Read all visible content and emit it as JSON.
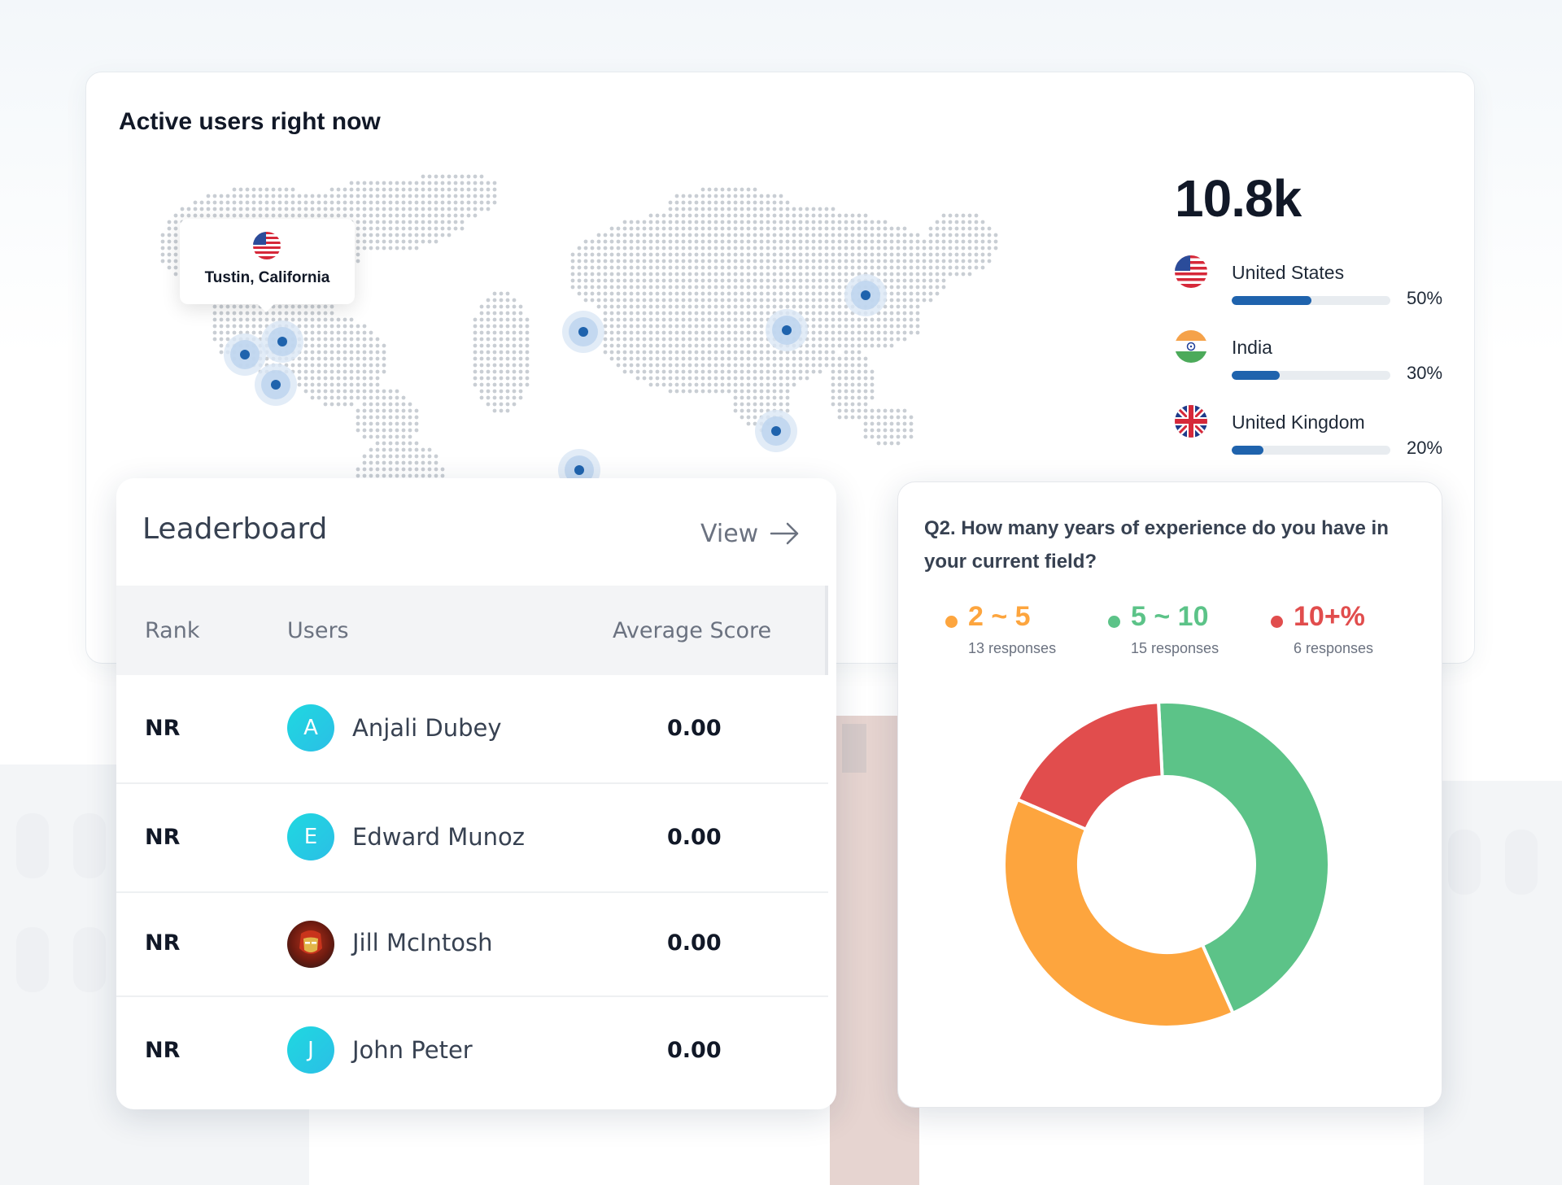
{
  "active_users": {
    "title": "Active users right now",
    "total": "10.8k",
    "tooltip": {
      "location": "Tustin, California",
      "flag_icon": "us-flag-icon"
    },
    "countries": [
      {
        "name": "United States",
        "percent": 50,
        "percent_label": "50%",
        "flag_icon": "us-flag-icon"
      },
      {
        "name": "India",
        "percent": 30,
        "percent_label": "30%",
        "flag_icon": "india-flag-icon"
      },
      {
        "name": "United Kingdom",
        "percent": 20,
        "percent_label": "20%",
        "flag_icon": "uk-flag-icon"
      }
    ],
    "bar_color": "#1f63ad"
  },
  "leaderboard": {
    "title": "Leaderboard",
    "view_label": "View",
    "columns": {
      "rank": "Rank",
      "users": "Users",
      "score": "Average Score"
    },
    "rows": [
      {
        "rank": "NR",
        "initial": "A",
        "name": "Anjali Dubey",
        "score": "0.00",
        "avatar": "initial"
      },
      {
        "rank": "NR",
        "initial": "E",
        "name": "Edward Munoz",
        "score": "0.00",
        "avatar": "initial"
      },
      {
        "rank": "NR",
        "initial": "",
        "name": "Jill McIntosh",
        "score": "0.00",
        "avatar": "photo"
      },
      {
        "rank": "NR",
        "initial": "J",
        "name": "John Peter",
        "score": "0.00",
        "avatar": "initial"
      }
    ],
    "avatar_color": "#22cfe3"
  },
  "survey": {
    "question": "Q2. How many years of experience do you have in your current field?",
    "options": [
      {
        "label": "2 ~ 5",
        "responses": "13 responses",
        "color": "#fda53e"
      },
      {
        "label": "5 ~ 10",
        "responses": "15 responses",
        "color": "#5cc388"
      },
      {
        "label": "10+%",
        "responses": "6 responses",
        "color": "#e14d4d"
      }
    ]
  },
  "chart_data": {
    "type": "pie",
    "variant": "donut",
    "categories": [
      "2 ~ 5",
      "5 ~ 10",
      "10+%"
    ],
    "values": [
      13,
      15,
      6
    ],
    "colors": [
      "#fda53e",
      "#5cc388",
      "#e14d4d"
    ]
  }
}
